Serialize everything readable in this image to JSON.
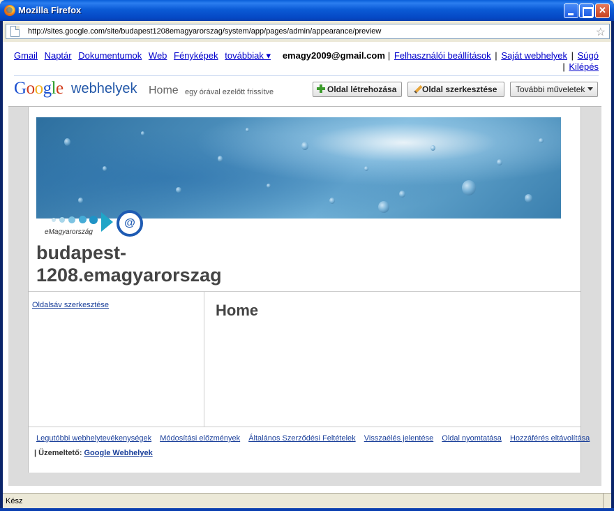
{
  "window": {
    "title": "Mozilla Firefox",
    "url": "http://sites.google.com/site/budapest1208emagyarorszag/system/app/pages/admin/appearance/preview"
  },
  "topnav": {
    "links": [
      "Gmail",
      "Naptár",
      "Dokumentumok",
      "Web",
      "Fényképek"
    ],
    "more": "továbbiak ▾",
    "email": "emagy2009@gmail.com",
    "user_settings": "Felhasználói beállítások",
    "my_sites": "Saját webhelyek",
    "help": "Súgó",
    "logout": "Kilépés",
    "separator": "|"
  },
  "header": {
    "logo_google": "Google",
    "logo_sites": "webhelyek",
    "page_name": "Home",
    "updated": "egy órával ezelőtt frissítve",
    "create_button": "Oldal létrehozása",
    "edit_button": "Oldal szerkesztése",
    "more_button": "További műveletek"
  },
  "site": {
    "logo_text": "eMagyarország",
    "logo_at": "@",
    "title": "budapest-1208.emagyarorszag",
    "sidebar_edit": "Oldalsáv szerkesztése",
    "page_heading": "Home"
  },
  "footer": {
    "links": [
      "Legutóbbi webhelytevékenységek",
      "Módosítási előzmények",
      "Általános Szerződési Feltételek",
      "Visszaélés jelentése",
      "Oldal nyomtatása",
      "Hozzáférés eltávolítása"
    ],
    "operator_label": "| Üzemeltető:",
    "operator_link": "Google Webhelyek"
  },
  "status": {
    "text": "Kész"
  }
}
